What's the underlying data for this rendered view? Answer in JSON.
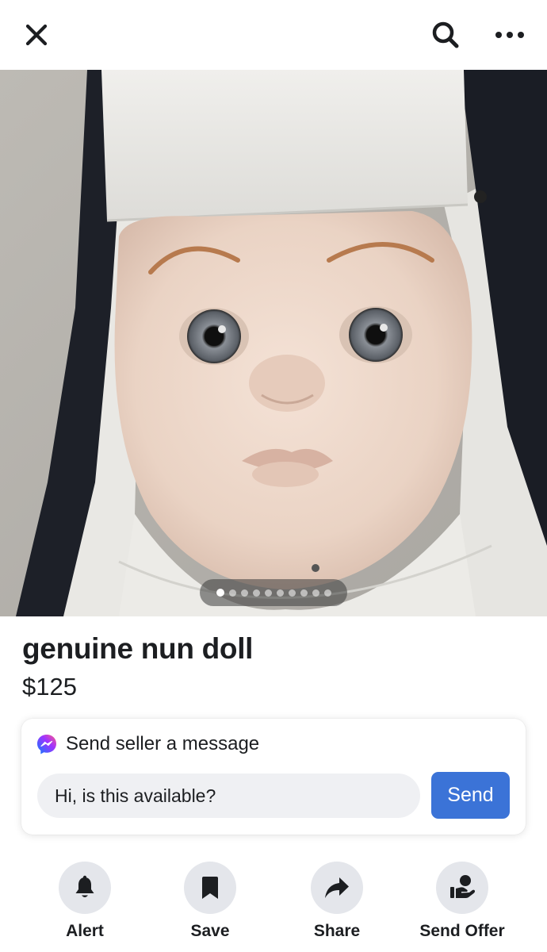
{
  "header": {
    "close_icon": "close-icon",
    "search_icon": "search-icon",
    "more_icon": "more-icon"
  },
  "photo": {
    "subject": "nun doll portrait",
    "page_count": 10,
    "active_index": 0
  },
  "listing": {
    "title": "genuine nun doll",
    "price": "$125"
  },
  "message": {
    "heading": "Send seller a message",
    "icon": "messenger-icon",
    "input_value": "Hi, is this available?",
    "send_label": "Send"
  },
  "actions": [
    {
      "label": "Alert",
      "icon": "bell-icon"
    },
    {
      "label": "Save",
      "icon": "bookmark-icon"
    },
    {
      "label": "Share",
      "icon": "share-arrow-icon"
    },
    {
      "label": "Send Offer",
      "icon": "offer-hand-icon"
    }
  ],
  "colors": {
    "accent": "#3b73d7",
    "text": "#1c1e21",
    "action_bg": "#e4e6eb",
    "input_bg": "#eff0f3"
  }
}
